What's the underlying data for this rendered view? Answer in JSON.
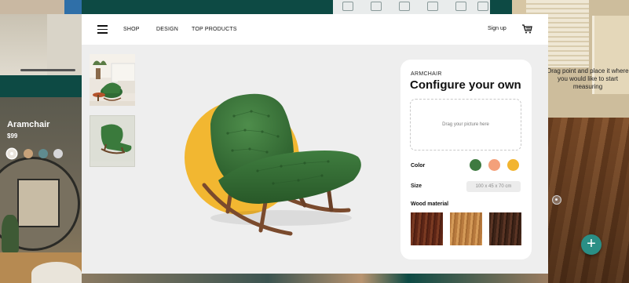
{
  "nav": {
    "links": [
      "SHOP",
      "DESIGN",
      "TOP PRODUCTS"
    ],
    "signup": "Sign up",
    "cart_icon": "cart-icon",
    "menu_icon": "hamburger-icon"
  },
  "config": {
    "category": "ARMCHAIR",
    "title": "Configure your own",
    "dropzone_text": "Drag your picture here",
    "color_label": "Color",
    "colors": [
      "#3e7a40",
      "#f4a07a",
      "#f2b42f"
    ],
    "size_label": "Size",
    "size_value": "100 x 45 x 70 cm",
    "wood_label": "Wood material",
    "woods": [
      "#6b2e1a",
      "#c48647",
      "#4a2a1b"
    ]
  },
  "side_card": {
    "title": "Aramchair",
    "price": "$99",
    "swatches": [
      "#e9e4dc",
      "#c7a27a",
      "#5f8b8f",
      "#d6d6d8"
    ],
    "selected_swatch": "#e9e4dc"
  },
  "ar_hint": {
    "text": "Drag point and place it where you would like to start measuring"
  },
  "plus_button": {
    "label": "+"
  },
  "colors": {
    "accent_teal": "#0d4a44",
    "chair_green": "#3c7a3c",
    "circle_yellow": "#f2b731"
  }
}
